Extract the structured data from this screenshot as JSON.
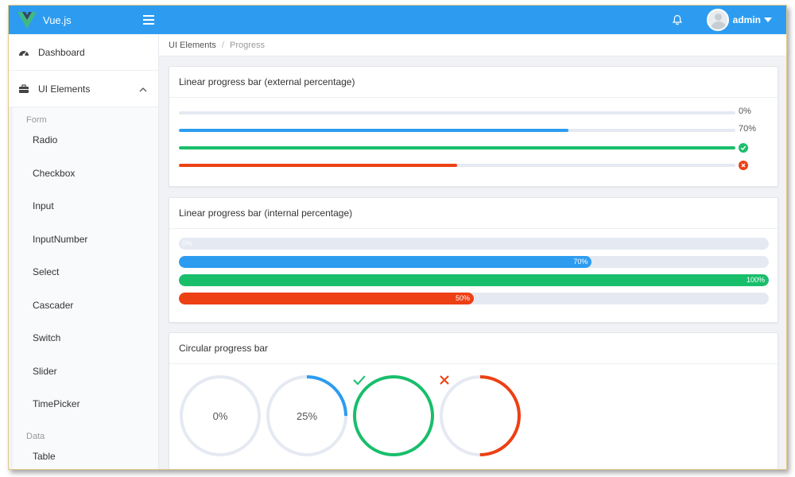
{
  "app": {
    "title": "Vue.js",
    "user": "admin"
  },
  "colors": {
    "primary": "#2d9cf0",
    "success": "#19be6b",
    "danger": "#ed4014",
    "track": "#e5e9f2"
  },
  "sidebar": {
    "items": [
      {
        "label": "Dashboard",
        "icon": "dashboard-icon"
      },
      {
        "label": "UI Elements",
        "icon": "briefcase-icon"
      }
    ],
    "groups": [
      {
        "title": "Form",
        "items": [
          "Radio",
          "Checkbox",
          "Input",
          "InputNumber",
          "Select",
          "Cascader",
          "Switch",
          "Slider",
          "TimePicker"
        ]
      },
      {
        "title": "Data",
        "items": [
          "Table"
        ]
      }
    ]
  },
  "breadcrumb": {
    "parent": "UI Elements",
    "separator": "/",
    "current": "Progress"
  },
  "cards": {
    "external": {
      "title": "Linear progress bar (external percentage)",
      "rows": [
        {
          "percent": 0,
          "label": "0%",
          "status": "normal"
        },
        {
          "percent": 70,
          "label": "70%",
          "status": "normal"
        },
        {
          "percent": 100,
          "label": "",
          "status": "success"
        },
        {
          "percent": 50,
          "label": "",
          "status": "exception"
        }
      ]
    },
    "internal": {
      "title": "Linear progress bar (internal percentage)",
      "rows": [
        {
          "percent": 0,
          "label": "0%",
          "status": "normal"
        },
        {
          "percent": 70,
          "label": "70%",
          "status": "normal"
        },
        {
          "percent": 100,
          "label": "100%",
          "status": "success"
        },
        {
          "percent": 50,
          "label": "50%",
          "status": "exception"
        }
      ]
    },
    "circular": {
      "title": "Circular progress bar",
      "items": [
        {
          "percent": 0,
          "label": "0%",
          "status": "normal"
        },
        {
          "percent": 25,
          "label": "25%",
          "status": "normal"
        },
        {
          "percent": 100,
          "label": "",
          "status": "success"
        },
        {
          "percent": 50,
          "label": "",
          "status": "exception"
        }
      ]
    }
  }
}
